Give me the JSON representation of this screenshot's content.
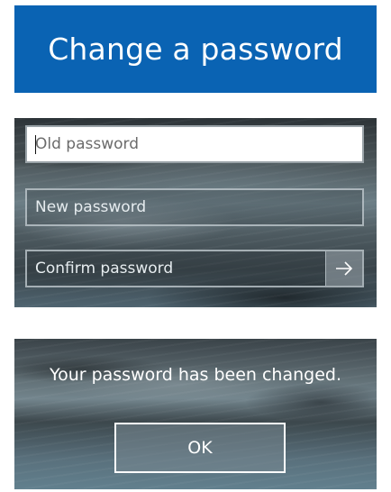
{
  "header": {
    "title": "Change a password",
    "background_color": "#0a63b3"
  },
  "form": {
    "old_password": {
      "placeholder": "Old password",
      "value": ""
    },
    "new_password": {
      "placeholder": "New password",
      "value": ""
    },
    "confirm_password": {
      "placeholder": "Confirm password",
      "value": ""
    },
    "submit_icon": "arrow-right-icon"
  },
  "confirmation": {
    "message": "Your password has been changed.",
    "ok_label": "OK"
  }
}
